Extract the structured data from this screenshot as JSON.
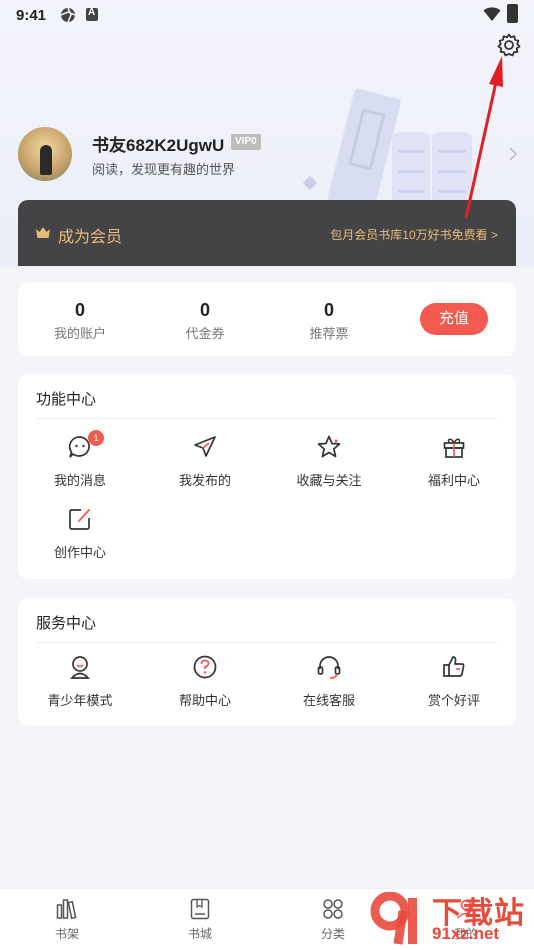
{
  "status_bar": {
    "time": "9:41"
  },
  "profile": {
    "username": "书友682K2UgwU",
    "vip_level": "VIP0",
    "tagline": "阅读，发现更有趣的世界"
  },
  "vip_banner": {
    "title": "成为会员",
    "promo": "包月会员书库10万好书免费看 >"
  },
  "wallet": {
    "stats": [
      {
        "value": "0",
        "label": "我的账户"
      },
      {
        "value": "0",
        "label": "代金券"
      },
      {
        "value": "0",
        "label": "推荐票"
      }
    ],
    "recharge_label": "充值"
  },
  "function_center": {
    "title": "功能中心",
    "items": [
      {
        "label": "我的消息",
        "icon": "message-icon",
        "badge": "1"
      },
      {
        "label": "我发布的",
        "icon": "send-icon"
      },
      {
        "label": "收藏与关注",
        "icon": "star-icon"
      },
      {
        "label": "福利中心",
        "icon": "gift-icon"
      },
      {
        "label": "创作中心",
        "icon": "edit-icon"
      }
    ]
  },
  "service_center": {
    "title": "服务中心",
    "items": [
      {
        "label": "青少年模式",
        "icon": "teen-icon"
      },
      {
        "label": "帮助中心",
        "icon": "help-icon"
      },
      {
        "label": "在线客服",
        "icon": "headset-icon"
      },
      {
        "label": "赏个好评",
        "icon": "thumbs-up-icon"
      }
    ]
  },
  "bottom_nav": [
    {
      "label": "书架",
      "icon": "bookshelf-icon"
    },
    {
      "label": "书城",
      "icon": "bookstore-icon"
    },
    {
      "label": "分类",
      "icon": "category-icon"
    },
    {
      "label": "我的",
      "icon": "profile-icon"
    }
  ],
  "watermark": {
    "title": "下载站",
    "url": "91xz.net"
  },
  "colors": {
    "accent": "#f25a50",
    "gold": "#e8bb7a",
    "banner": "#444446",
    "arrow": "#e01e24"
  }
}
